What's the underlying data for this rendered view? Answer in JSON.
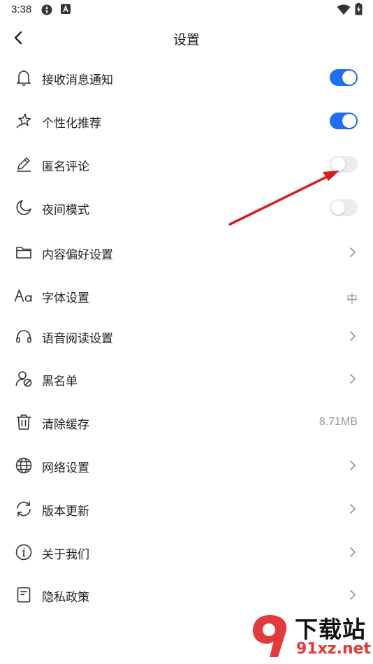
{
  "status_bar": {
    "time": "3:38"
  },
  "header": {
    "title": "设置"
  },
  "settings": [
    {
      "label": "接收消息通知",
      "icon": "bell-icon",
      "control": "toggle",
      "on": true
    },
    {
      "label": "个性化推荐",
      "icon": "star-sparkle-icon",
      "control": "toggle",
      "on": true
    },
    {
      "label": "匿名评论",
      "icon": "pencil-icon",
      "control": "toggle",
      "on": false
    },
    {
      "label": "夜间模式",
      "icon": "moon-icon",
      "control": "toggle",
      "on": false
    },
    {
      "label": "内容偏好设置",
      "icon": "folder-icon",
      "control": "chevron"
    },
    {
      "label": "字体设置",
      "icon": "font-aa-icon",
      "control": "value",
      "value": "中"
    },
    {
      "label": "语音阅读设置",
      "icon": "headphones-icon",
      "control": "chevron"
    },
    {
      "label": "黑名单",
      "icon": "block-user-icon",
      "control": "chevron"
    },
    {
      "label": "清除缓存",
      "icon": "trash-icon",
      "control": "value",
      "value": "8.71MB"
    },
    {
      "label": "网络设置",
      "icon": "globe-icon",
      "control": "chevron"
    },
    {
      "label": "版本更新",
      "icon": "refresh-icon",
      "control": "chevron"
    },
    {
      "label": "关于我们",
      "icon": "info-icon",
      "control": "chevron"
    },
    {
      "label": "隐私政策",
      "icon": "document-icon",
      "control": "chevron"
    }
  ],
  "watermark": {
    "title": "下载站",
    "url": "91xz.net"
  },
  "colors": {
    "accent": "#1e6ff1",
    "toggle_off": "#ececec",
    "annotation_arrow": "#d81e1e",
    "watermark_red": "#e03a3a"
  }
}
